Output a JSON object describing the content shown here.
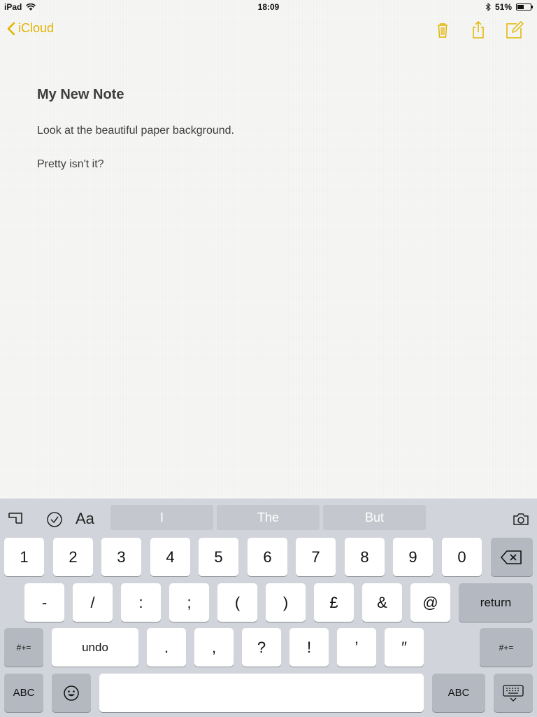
{
  "status": {
    "device": "iPad",
    "time": "18:09",
    "battery": "51%",
    "battery_level": 0.51
  },
  "nav": {
    "back_label": "iCloud"
  },
  "note": {
    "title": "My New Note",
    "lines": [
      "Look at the beautiful paper background.",
      "Pretty isn't it?"
    ]
  },
  "keyboard": {
    "suggestions": [
      "I",
      "The",
      "But"
    ],
    "format_label": "Aa",
    "row1": [
      "1",
      "2",
      "3",
      "4",
      "5",
      "6",
      "7",
      "8",
      "9",
      "0"
    ],
    "row2": [
      "-",
      "/",
      ":",
      ";",
      "(",
      ")",
      "£",
      "&",
      "@"
    ],
    "row3": [
      ".",
      ",",
      "?",
      "!",
      "’",
      "″"
    ],
    "return_label": "return",
    "shift_label": "#+=",
    "undo_label": "undo",
    "abc_label": "ABC"
  },
  "colors": {
    "accent": "#e2b400"
  }
}
